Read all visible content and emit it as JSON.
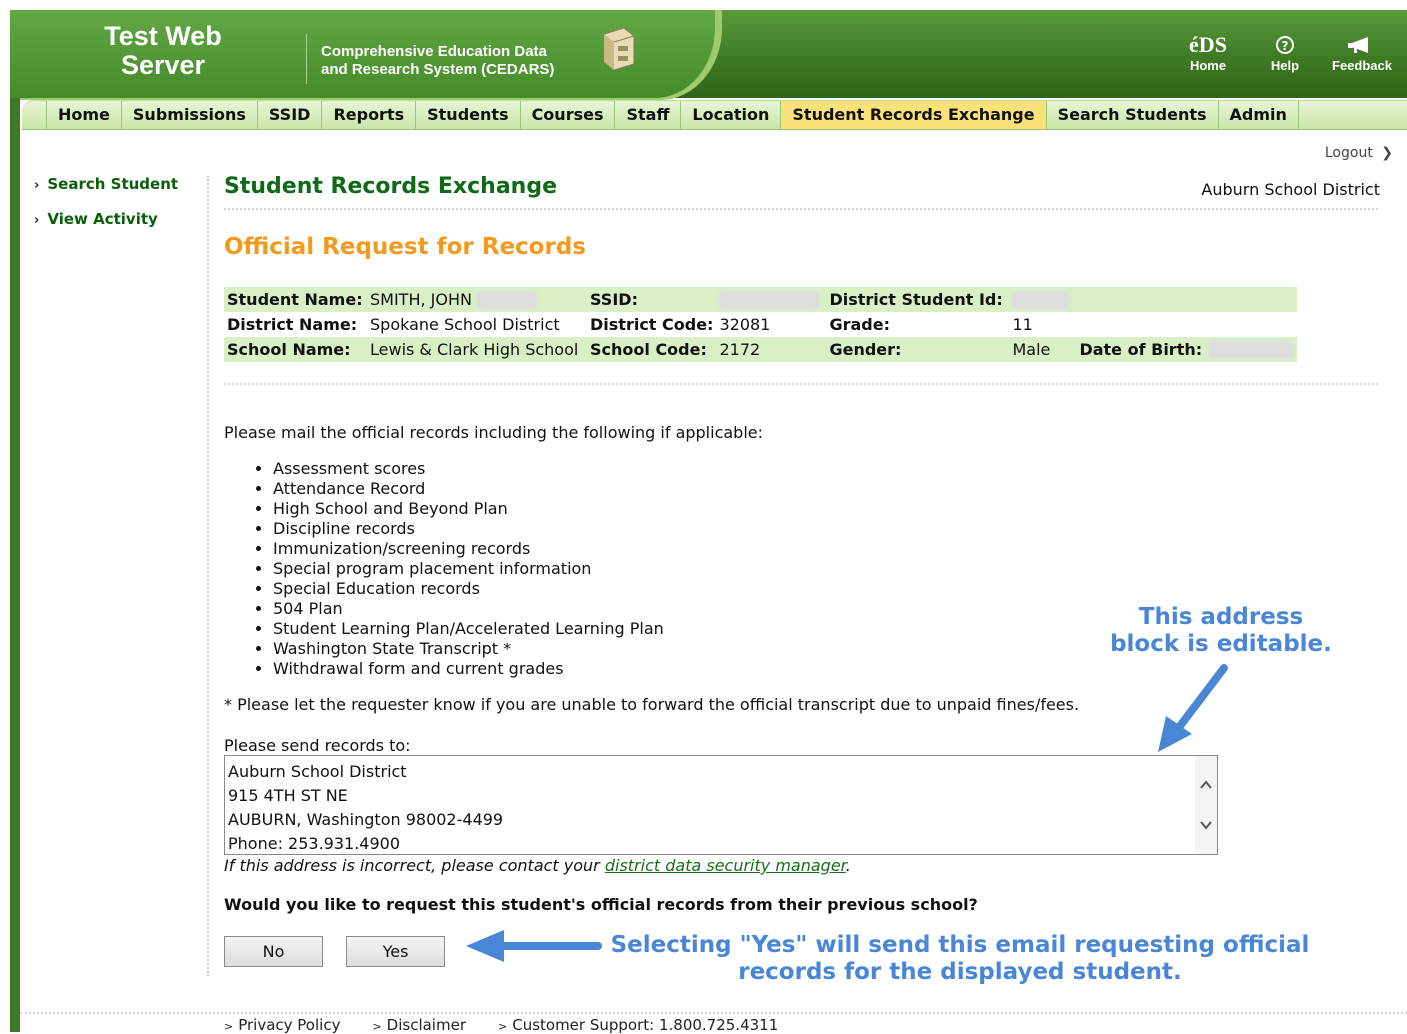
{
  "header": {
    "server_title_line1": "Test Web",
    "server_title_line2": "Server",
    "cedars_line1": "Comprehensive Education Data",
    "cedars_line2": "and Research System (CEDARS)",
    "logo_text": "éDS",
    "links": [
      {
        "label": "Home",
        "icon": "eds-logo-icon"
      },
      {
        "label": "Help",
        "icon": "help-icon"
      },
      {
        "label": "Feedback",
        "icon": "megaphone-icon"
      }
    ]
  },
  "nav": {
    "tabs": [
      "Home",
      "Submissions",
      "SSID",
      "Reports",
      "Students",
      "Courses",
      "Staff",
      "Location",
      "Student Records Exchange",
      "Search Students",
      "Admin"
    ],
    "active": "Student Records Exchange"
  },
  "logout_label": "Logout",
  "sidebar": {
    "items": [
      "Search Student",
      "View Activity"
    ]
  },
  "main": {
    "title": "Student Records Exchange",
    "district": "Auburn School District",
    "subtitle": "Official Request for Records",
    "info": {
      "student_name_label": "Student Name:",
      "student_name": "SMITH, JOHN",
      "ssid_label": "SSID:",
      "district_student_id_label": "District Student Id:",
      "district_name_label": "District Name:",
      "district_name": "Spokane School District",
      "district_code_label": "District Code:",
      "district_code": "32081",
      "grade_label": "Grade:",
      "grade": "11",
      "school_name_label": "School Name:",
      "school_name": "Lewis & Clark High School",
      "school_code_label": "School Code:",
      "school_code": "2172",
      "gender_label": "Gender:",
      "gender": "Male",
      "dob_label": "Date of Birth:"
    },
    "mail_intro": "Please mail the official records including the following if applicable:",
    "records": [
      "Assessment scores",
      "Attendance Record",
      "High School and Beyond Plan",
      "Discipline records",
      "Immunization/screening records",
      "Special program placement information",
      "Special Education records",
      "504 Plan",
      "Student Learning Plan/Accelerated Learning Plan",
      "Washington State Transcript *",
      "Withdrawal form and current grades"
    ],
    "fee_note": "* Please let the requester know if you are unable to forward the official transcript due to unpaid fines/fees.",
    "send_label": "Please send records to:",
    "address_lines": [
      "Auburn School District",
      "915 4TH ST NE",
      "AUBURN, Washington 98002-4499",
      "Phone: 253.931.4900"
    ],
    "incorrect_prefix": "If this address is incorrect, please contact your ",
    "incorrect_link": "district data security manager",
    "incorrect_suffix": ".",
    "question": "Would you like to request this student's official records from their previous school?",
    "no_label": "No",
    "yes_label": "Yes"
  },
  "annotations": {
    "address_line1": "This address",
    "address_line2": "block is editable.",
    "yes_line1": "Selecting \"Yes\" will send this email requesting official",
    "yes_line2": "records for the displayed student."
  },
  "footer": {
    "privacy": "Privacy Policy",
    "disclaimer": "Disclaimer",
    "support": "Customer Support: 1.800.725.4311"
  },
  "colors": {
    "header_green": "#3e7a24",
    "title_green": "#0e6a18",
    "subtitle_orange": "#f39a1e",
    "active_tab": "#f9e27a",
    "row_shade": "#d9f0c6",
    "annotation_blue": "#4a86d6"
  }
}
